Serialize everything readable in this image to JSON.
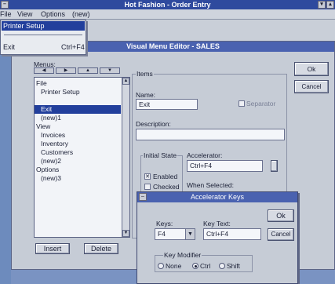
{
  "app": {
    "title": "Hot Fashion - Order Entry"
  },
  "menubar": {
    "items": [
      "File",
      "View",
      "Options",
      "(new)"
    ]
  },
  "dropdown": {
    "items": [
      {
        "label": "Printer Setup",
        "shortcut": ""
      },
      {
        "label": "Exit",
        "shortcut": "Ctrl+F4"
      }
    ]
  },
  "editor": {
    "title": "Visual Menu Editor - SALES",
    "menus_label": "Menus:",
    "menu_items": [
      "File",
      "Printer Setup",
      "",
      "Exit",
      "(new)1",
      "View",
      "Invoices",
      "Inventory",
      "Customers",
      "(new)2",
      "Options",
      "(new)3"
    ],
    "insert_label": "Insert",
    "delete_label": "Delete",
    "ok_label": "Ok",
    "cancel_label": "Cancel",
    "items_group": "Items",
    "name_label": "Name:",
    "name_value": "Exit",
    "separator_label": "Separator",
    "description_label": "Description:",
    "initial_state_label": "Initial State",
    "enabled_label": "Enabled",
    "checked_label": "Checked",
    "accelerator_label": "Accelerator:",
    "accelerator_value": "Ctrl+F4",
    "when_selected_label": "When Selected:"
  },
  "accel_dialog": {
    "title": "Accelerator Keys",
    "keys_label": "Keys:",
    "keys_value": "F4",
    "key_text_label": "Key Text:",
    "key_text_value": "Ctrl+F4",
    "ok_label": "Ok",
    "cancel_label": "Cancel",
    "modifier_label": "Key Modifier",
    "none_label": "None",
    "ctrl_label": "Ctrl",
    "shift_label": "Shift"
  }
}
